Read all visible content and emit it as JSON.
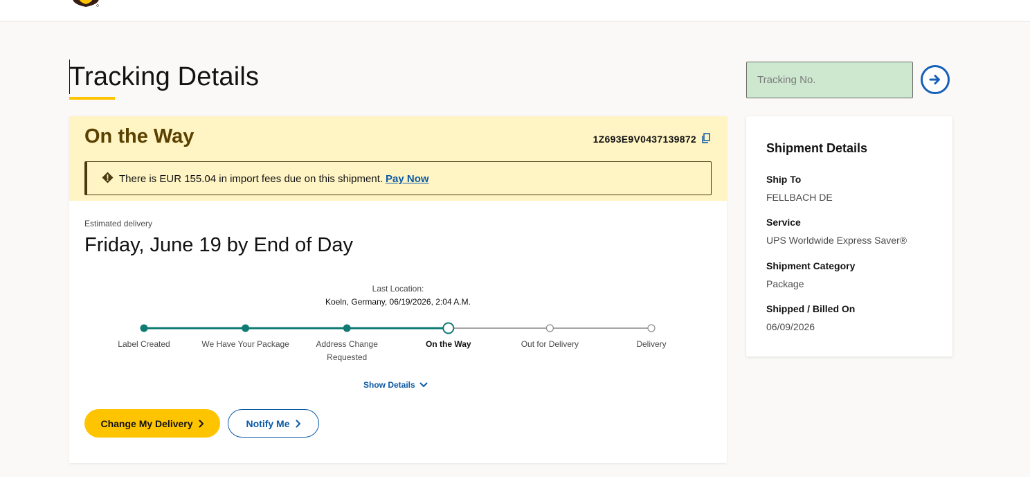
{
  "header": {
    "logo_icon": "ups-shield-logo",
    "brand_color": "#351c15",
    "accent_color": "#ffc400"
  },
  "page": {
    "title": "Tracking Details"
  },
  "search": {
    "placeholder": "Tracking No.",
    "value": "",
    "go_icon": "arrow-right-circle-icon"
  },
  "status": {
    "title": "On the Way",
    "tracking_number": "1Z693E9V0437139872",
    "copy_icon": "copy-icon",
    "band_color": "#fff4c4"
  },
  "alert": {
    "icon": "diamond-exclamation-icon",
    "text": "There is EUR 155.04 in import fees due on this shipment.",
    "link_label": "Pay Now"
  },
  "delivery": {
    "estimated_label": "Estimated delivery",
    "estimated_date": "Friday, June 19 by End of Day"
  },
  "last_location": {
    "label": "Last Location:",
    "value": "Koeln, Germany, 06/19/2026, 2:04 A.M."
  },
  "progress": {
    "current_index": 3,
    "completed_color": "#0f7b73",
    "pending_color": "#8a8a8a",
    "steps": [
      {
        "label": "Label Created",
        "state": "complete"
      },
      {
        "label": "We Have Your Package",
        "state": "complete"
      },
      {
        "label": "Address Change Requested",
        "state": "complete"
      },
      {
        "label": "On the Way",
        "state": "current"
      },
      {
        "label": "Out for Delivery",
        "state": "pending"
      },
      {
        "label": "Delivery",
        "state": "pending"
      }
    ]
  },
  "details_toggle": {
    "label": "Show Details",
    "icon": "chevron-down-icon"
  },
  "actions": {
    "change_delivery": "Change My Delivery",
    "notify_me": "Notify Me",
    "icon": "chevron-right-icon"
  },
  "shipment_details": {
    "title": "Shipment Details",
    "items": [
      {
        "label": "Ship To",
        "value": "FELLBACH DE"
      },
      {
        "label": "Service",
        "value": "UPS Worldwide Express Saver®"
      },
      {
        "label": "Shipment Category",
        "value": "Package"
      },
      {
        "label": "Shipped / Billed On",
        "value": "06/09/2026"
      }
    ]
  }
}
